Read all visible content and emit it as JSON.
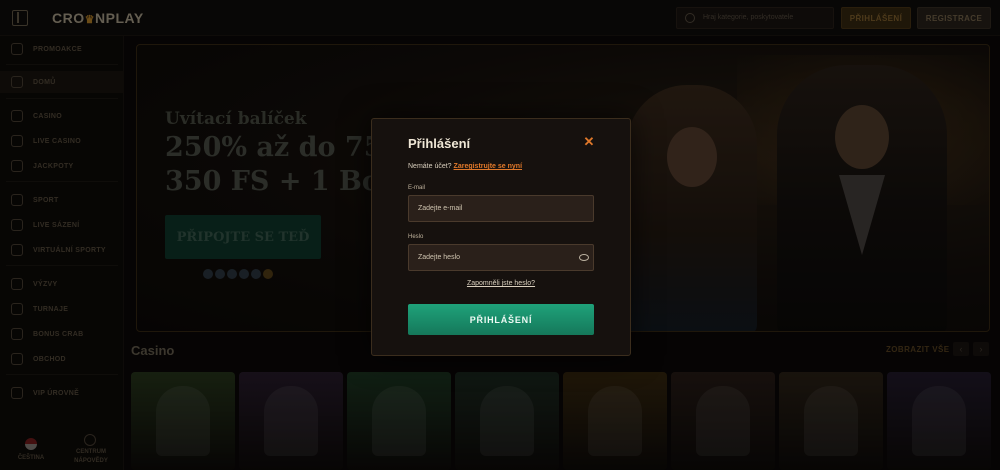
{
  "header": {
    "logo_text_a": "CRO",
    "logo_crown": "♛",
    "logo_text_b": "NPLAY",
    "search_placeholder": "Hraj kategorie, poskytovatele",
    "login_label": "PŘIHLÁŠENÍ",
    "register_label": "REGISTRACE"
  },
  "sidebar": {
    "items": [
      {
        "label": "PROMOAKCE",
        "icon": "gift-icon"
      },
      {
        "label": "DOMŮ",
        "icon": "home-icon"
      },
      {
        "label": "CASINO",
        "icon": "casino-icon"
      },
      {
        "label": "LIVE CASINO",
        "icon": "live-casino-icon"
      },
      {
        "label": "JACKPOTY",
        "icon": "jackpot-icon"
      },
      {
        "label": "SPORT",
        "icon": "sport-icon"
      },
      {
        "label": "LIVE SÁZENÍ",
        "icon": "live-betting-icon"
      },
      {
        "label": "VIRTUÁLNÍ SPORTY",
        "icon": "virtual-sports-icon"
      },
      {
        "label": "VÝZVY",
        "icon": "trophy-icon"
      },
      {
        "label": "TURNAJE",
        "icon": "tournament-icon"
      },
      {
        "label": "BONUS CRAB",
        "icon": "crab-icon"
      },
      {
        "label": "OBCHOD",
        "icon": "shop-icon"
      },
      {
        "label": "VIP ÚROVNĚ",
        "icon": "vip-icon"
      }
    ],
    "language_label": "ČEŠTINA",
    "help_label_1": "CENTRUM",
    "help_label_2": "NÁPOVĚDY"
  },
  "banner": {
    "subtitle": "Uvítací balíček",
    "title_line1": "250% až do 75",
    "title_line2": "350 FS + 1 Bon",
    "cta_label": "PŘIPOJTE SE TEĎ"
  },
  "casino": {
    "title": "Casino",
    "see_all_label": "ZOBRAZIT VŠE",
    "prev": "‹",
    "next": "›",
    "games": [
      {
        "color": "#2a3a1e"
      },
      {
        "color": "#2a1e2e"
      },
      {
        "color": "#1f3a24"
      },
      {
        "color": "#1e2c22"
      },
      {
        "color": "#3a2a10"
      },
      {
        "color": "#2a1e18"
      },
      {
        "color": "#2e2418"
      },
      {
        "color": "#241c2e"
      }
    ]
  },
  "modal": {
    "title": "Přihlášení",
    "close": "✕",
    "no_account_text": "Nemáte účet?",
    "register_link": "Zaregistrujte se nyní",
    "email_label": "E-mail",
    "email_placeholder": "Zadejte e-mail",
    "password_label": "Heslo",
    "password_placeholder": "Zadejte heslo",
    "forgot_password": "Zapomněli jste heslo?",
    "submit_label": "PŘIHLÁŠENÍ"
  },
  "colors": {
    "accent": "#e0782a",
    "submit_green": "#1a8f6a",
    "background": "#0b0908"
  }
}
